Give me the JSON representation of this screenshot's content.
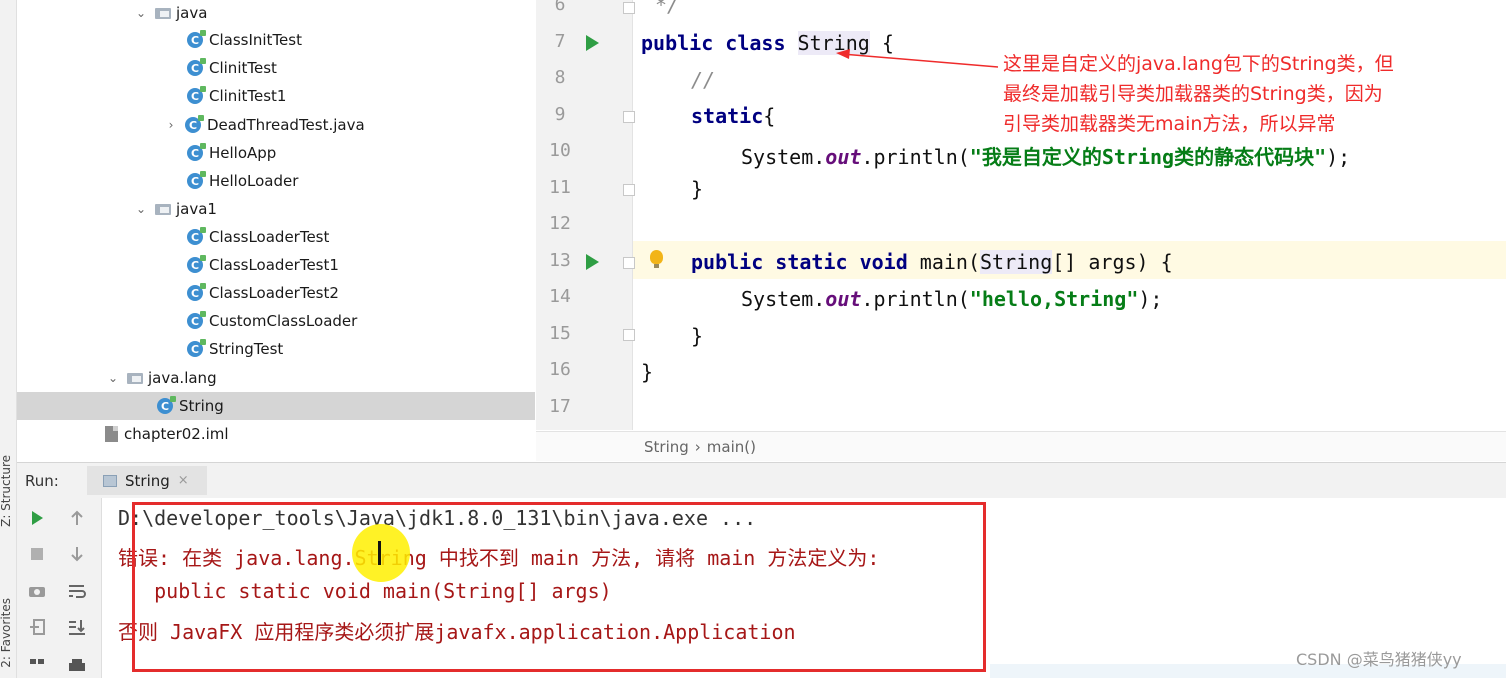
{
  "sidebar_tabs": {
    "structure": "Z: Structure",
    "favorites": "2: Favorites"
  },
  "project_tree": [
    {
      "type": "folder",
      "label": "java",
      "expanded": true
    },
    {
      "type": "class",
      "label": "ClassInitTest"
    },
    {
      "type": "class",
      "label": "ClinitTest"
    },
    {
      "type": "class",
      "label": "ClinitTest1"
    },
    {
      "type": "class",
      "label": "DeadThreadTest.java",
      "collapsed": true
    },
    {
      "type": "class",
      "label": "HelloApp"
    },
    {
      "type": "class",
      "label": "HelloLoader"
    },
    {
      "type": "folder",
      "label": "java1",
      "expanded": true
    },
    {
      "type": "class",
      "label": "ClassLoaderTest"
    },
    {
      "type": "class",
      "label": "ClassLoaderTest1"
    },
    {
      "type": "class",
      "label": "ClassLoaderTest2"
    },
    {
      "type": "class",
      "label": "CustomClassLoader"
    },
    {
      "type": "class",
      "label": "StringTest"
    },
    {
      "type": "folder",
      "label": "java.lang",
      "expanded": true
    },
    {
      "type": "class",
      "label": "String",
      "selected": true
    },
    {
      "type": "file",
      "label": "chapter02.iml"
    }
  ],
  "editor": {
    "line_numbers": [
      "6",
      "7",
      "8",
      "9",
      "10",
      "11",
      "12",
      "13",
      "14",
      "15",
      "16",
      "17"
    ],
    "code": {
      "l6": "*/",
      "l7_kw": "public class ",
      "l7_name": "String",
      "l7_rest": " {",
      "l8": "//",
      "l9_kw": "static",
      "l9_rest": "{",
      "l10_pre": "System.",
      "l10_field": "out",
      "l10_mid": ".println(",
      "l10_str": "\"我是自定义的String类的静态代码块\"",
      "l10_end": ");",
      "l11": "}",
      "l13_kw": "public static void ",
      "l13_mid": "main(",
      "l13_type": "String",
      "l13_rest": "[] args) {",
      "l14_pre": "System.",
      "l14_field": "out",
      "l14_mid": ".println(",
      "l14_str": "\"hello,String\"",
      "l14_end": ");",
      "l15": "}",
      "l16": "}"
    },
    "breadcrumb": {
      "class": "String",
      "sep": "›",
      "method": "main()"
    }
  },
  "annotation": {
    "line1": "这里是自定义的java.lang包下的String类，但",
    "line2": "最终是加载引导类加载器类的String类，因为",
    "line3": "引导类加载器类无main方法，所以异常",
    "color": "#ef2b2b"
  },
  "run_panel": {
    "label": "Run:",
    "tab": "String",
    "close": "×",
    "console": {
      "line1": "D:\\developer_tools\\Java\\jdk1.8.0_131\\bin\\java.exe ...",
      "line2": "错误: 在类 java.lang.String 中找不到 main 方法, 请将 main 方法定义为:",
      "line3": "   public static void main(String[] args)",
      "line4": "否则 JavaFX 应用程序类必须扩展javafx.application.Application"
    }
  },
  "watermark": "CSDN @菜鸟猪猪侠yy"
}
